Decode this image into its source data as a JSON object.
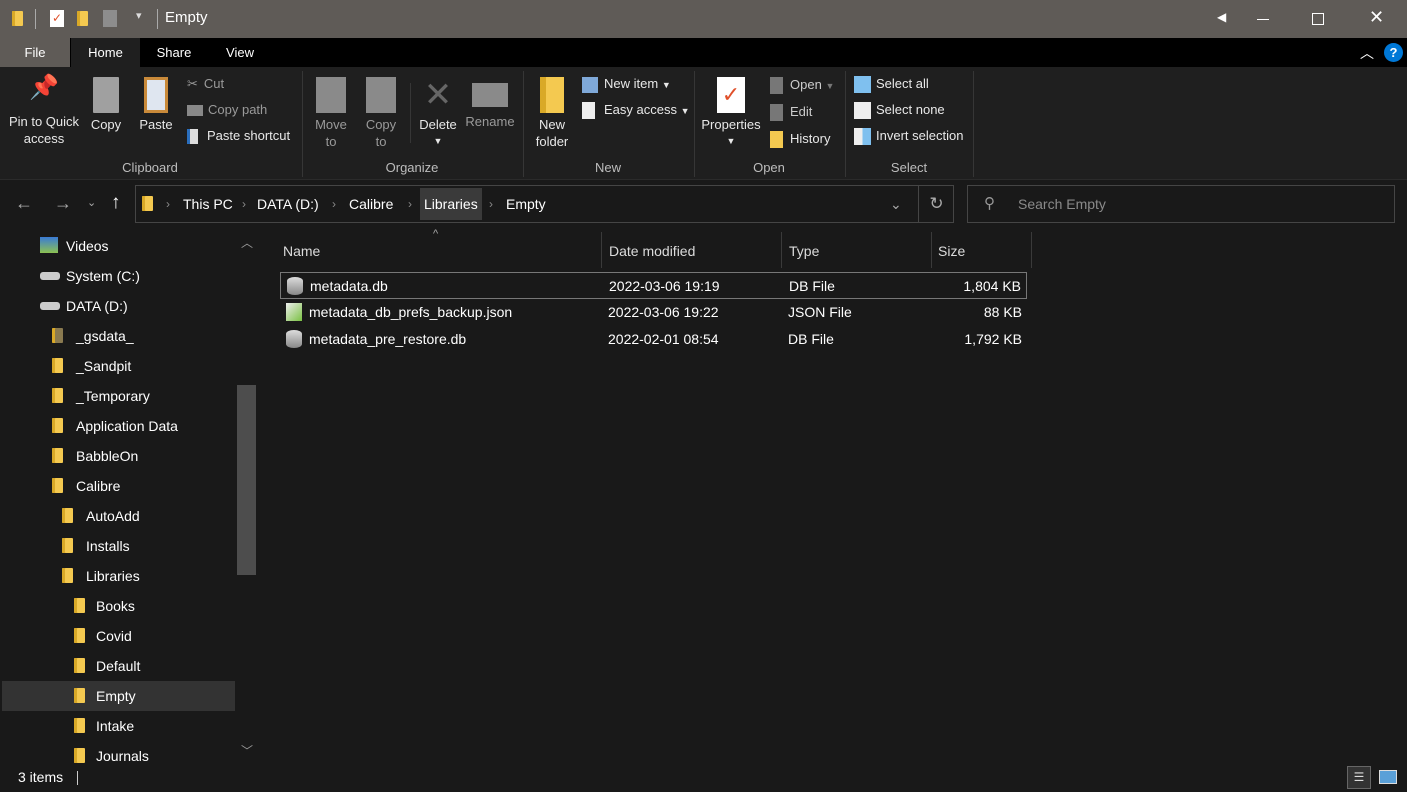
{
  "window": {
    "title": "Empty"
  },
  "tabs": {
    "file": "File",
    "home": "Home",
    "share": "Share",
    "view": "View"
  },
  "ribbon": {
    "clipboard": {
      "label": "Clipboard",
      "pin": "Pin to Quick access",
      "copy": "Copy",
      "paste": "Paste",
      "cut": "Cut",
      "copy_path": "Copy path",
      "paste_shortcut": "Paste shortcut"
    },
    "organize": {
      "label": "Organize",
      "move_to": "Move to",
      "copy_to": "Copy to",
      "delete": "Delete",
      "rename": "Rename"
    },
    "new": {
      "label": "New",
      "new_folder": "New folder",
      "new_item": "New item",
      "easy_access": "Easy access"
    },
    "open": {
      "label": "Open",
      "properties": "Properties",
      "open": "Open",
      "edit": "Edit",
      "history": "History"
    },
    "select": {
      "label": "Select",
      "select_all": "Select all",
      "select_none": "Select none",
      "invert": "Invert selection"
    }
  },
  "address": {
    "crumbs": [
      "This PC",
      "DATA (D:)",
      "Calibre",
      "Libraries",
      "Empty"
    ]
  },
  "search": {
    "placeholder": "Search Empty"
  },
  "sidebar": {
    "items": [
      "Videos",
      "System (C:)",
      "DATA (D:)",
      "_gsdata_",
      "_Sandpit",
      "_Temporary",
      "Application Data",
      "BabbleOn",
      "Calibre",
      "AutoAdd",
      "Installs",
      "Libraries",
      "Books",
      "Covid",
      "Default",
      "Empty",
      "Intake",
      "Journals"
    ]
  },
  "files": {
    "columns": [
      "Name",
      "Date modified",
      "Type",
      "Size"
    ],
    "rows": [
      {
        "name": "metadata.db",
        "date": "2022-03-06 19:19",
        "type": "DB File",
        "size": "1,804 KB"
      },
      {
        "name": "metadata_db_prefs_backup.json",
        "date": "2022-03-06 19:22",
        "type": "JSON File",
        "size": "88 KB"
      },
      {
        "name": "metadata_pre_restore.db",
        "date": "2022-02-01 08:54",
        "type": "DB File",
        "size": "1,792 KB"
      }
    ]
  },
  "status": {
    "count": "3 items"
  },
  "colors": {
    "accent": "#0078d7",
    "folder": "#f4c950",
    "titlebar": "#5f5b57"
  }
}
